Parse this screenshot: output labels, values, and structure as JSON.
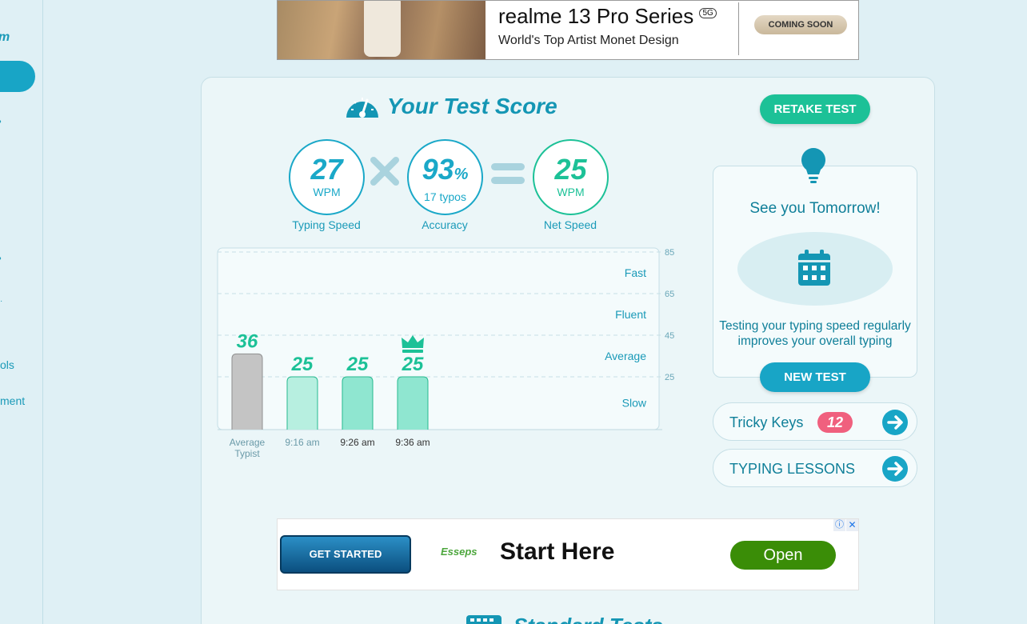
{
  "sidebar": {
    "logo_fragment": "m",
    "partial_items": [
      "ols",
      "ment"
    ]
  },
  "ad_top": {
    "brand": "realme 13 Pro Series",
    "badge": "5G",
    "tagline": "World's Top Artist Monet Design",
    "cta": "COMING SOON"
  },
  "score": {
    "title": "Your Test Score",
    "typing_speed": {
      "value": "27",
      "unit": "WPM",
      "caption": "Typing Speed"
    },
    "accuracy": {
      "value": "93",
      "unit": "%",
      "sub": "17 typos",
      "caption": "Accuracy"
    },
    "net_speed": {
      "value": "25",
      "unit": "WPM",
      "caption": "Net Speed"
    }
  },
  "chart_data": {
    "type": "bar",
    "categories": [
      "Average Typist",
      "9:16 am",
      "9:26 am",
      "9:36 am"
    ],
    "values": [
      36,
      25,
      25,
      25
    ],
    "y_ticks": [
      25,
      45,
      65,
      85
    ],
    "bands": [
      "Fast",
      "Fluent",
      "Average",
      "Slow"
    ],
    "best_marker_index": 3,
    "colors": {
      "average": "#c4c4c4",
      "result": "#8fe6d0",
      "result_light": "#b7efe0",
      "label": "#1cc197"
    }
  },
  "right": {
    "retake_label": "RETAKE TEST",
    "tomorrow_title": "See you Tomorrow!",
    "tomorrow_msg": "Testing your typing speed regularly improves your overall typing",
    "new_test_label": "NEW TEST",
    "tricky_keys_label": "Tricky Keys",
    "tricky_keys_count": "12",
    "lessons_label": "TYPING LESSONS"
  },
  "ad_bottom": {
    "button": "GET STARTED",
    "logo": "Esseps",
    "title": "Start Here",
    "open": "Open",
    "info_glyph": "ⓘ",
    "close_glyph": "✕"
  },
  "footer": {
    "section_title": "Standard Tests"
  }
}
